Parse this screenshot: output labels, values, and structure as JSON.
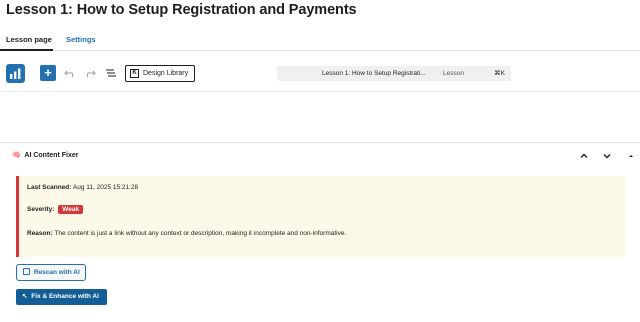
{
  "page": {
    "title": "Lesson 1: How to Setup Registration and Payments"
  },
  "tabs": [
    {
      "label": "Lesson page",
      "active": true
    },
    {
      "label": "Settings",
      "active": false
    }
  ],
  "toolbar": {
    "logo_icon": "bar-chart-icon",
    "add_icon": "plus-icon",
    "add_label": "+",
    "undo_icon": "undo-icon",
    "redo_icon": "redo-icon",
    "list_view_icon": "list-view-icon",
    "design_library_label": "Design Library",
    "design_library_icon_label": "K"
  },
  "command_bar": {
    "title": "Lesson 1: How to Setup Registrati...",
    "type": "· Lesson",
    "shortcut": "⌘K"
  },
  "panel": {
    "emoji": "🧠",
    "title": "AI Content Fixer",
    "controls": [
      "chevron-up-icon",
      "chevron-down-icon",
      "caret-up-icon"
    ]
  },
  "notice": {
    "last_scanned_label": "Last Scanned:",
    "last_scanned_value": "Aug 11, 2025 15:21:28",
    "severity_label": "Severity:",
    "severity_value": "Weak",
    "reason_label": "Reason:",
    "reason_value": "The content is just a link without any context or description, making it incomplete and non-informative."
  },
  "actions": {
    "rescan_label": "Rescan with AI",
    "rescan_icon": "refresh-icon",
    "fix_label": "Fix & Enhance with AI",
    "fix_icon": "magic-wand-icon"
  },
  "colors": {
    "accent": "#2271b1",
    "danger": "#d63638",
    "notice_bg": "#fcf9e8",
    "primary_dark": "#135e96"
  }
}
